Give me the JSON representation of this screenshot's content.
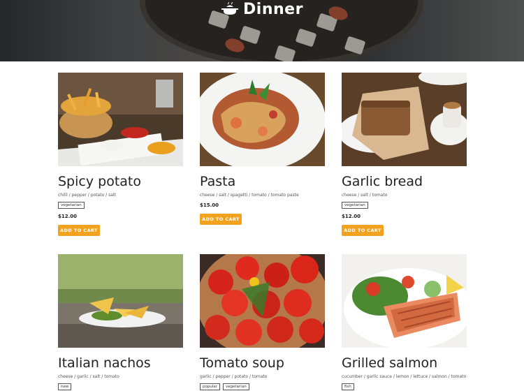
{
  "header": {
    "title": "Dinner",
    "icon": "cooking-pot-icon"
  },
  "dishes": [
    {
      "name": "Spicy potato",
      "ingredients": "chilli / pepper / potato / salt",
      "tags": [
        "vegetarian"
      ],
      "price": "$12.00",
      "button": "ADD TO CART"
    },
    {
      "name": "Pasta",
      "ingredients": "cheese / salt / spagetti / tomato / tomato paste",
      "tags": [],
      "price": "$15.00",
      "button": "ADD TO CART"
    },
    {
      "name": "Garlic bread",
      "ingredients": "cheese / salt / tomato",
      "tags": [
        "vegetarian"
      ],
      "price": "$12.00",
      "button": "ADD TO CART"
    },
    {
      "name": "Italian nachos",
      "ingredients": "cheese / garlic / salt / tomato",
      "tags": [
        "new"
      ]
    },
    {
      "name": "Tomato soup",
      "ingredients": "garlic / pepper / potato / tomato",
      "tags": [
        "popular",
        "vegetarian"
      ]
    },
    {
      "name": "Grilled salmon",
      "ingredients": "cucumber / garlic sauce / lemon / lettuce / salmon / tomato",
      "tags": [
        "fish"
      ]
    }
  ],
  "colors": {
    "button": "#f2a21f",
    "header_shade": "#3f4143"
  }
}
